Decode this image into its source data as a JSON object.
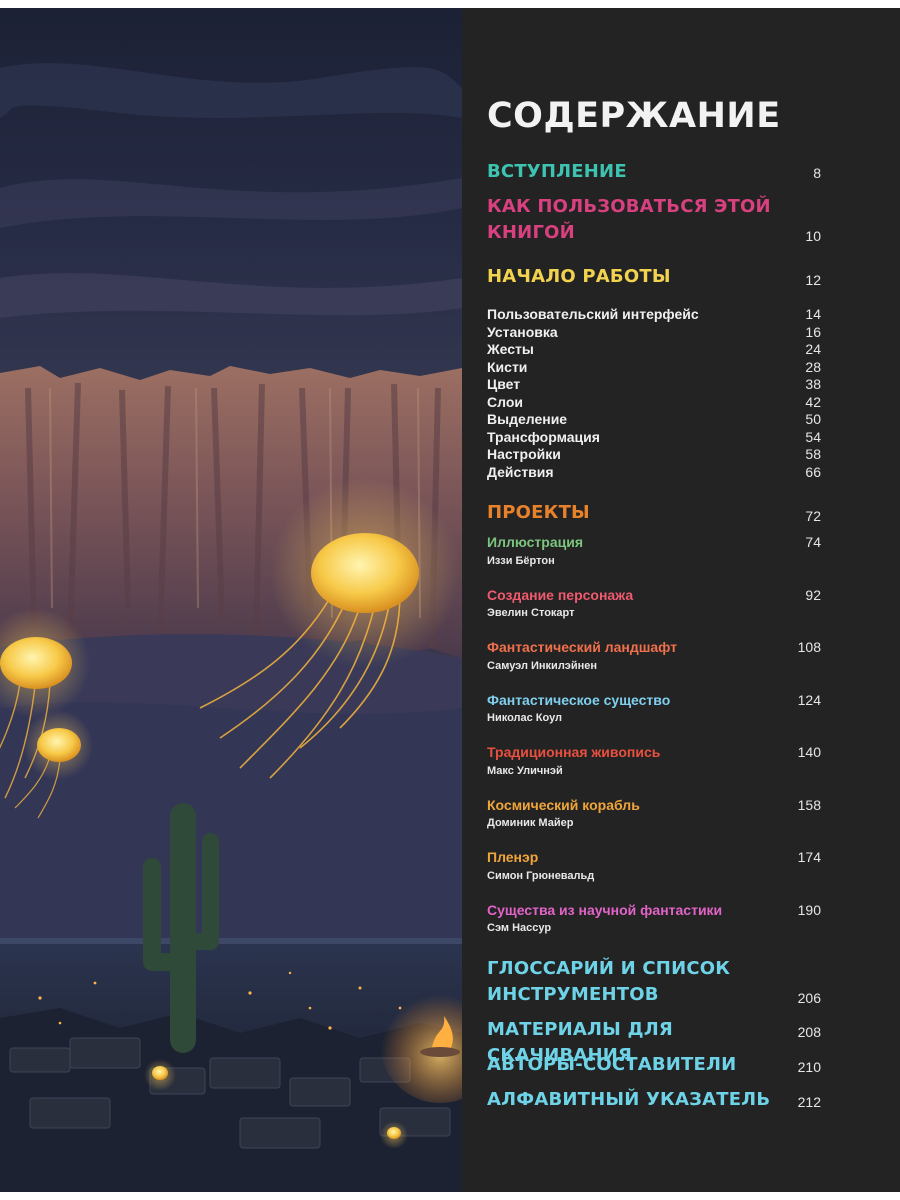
{
  "title": "СОДЕРЖАНИЕ",
  "colors": {
    "panel_bg": "#232323",
    "teal": "#3ec3b0",
    "magenta": "#d8407f",
    "yellow": "#f2d34f",
    "orange": "#e8822a",
    "green": "#7cc47f",
    "pink": "#ef5a6e",
    "coral": "#f0704d",
    "sky": "#7fd0ee",
    "red": "#e8503f",
    "gold": "#f0a53a",
    "amber": "#f0a53a",
    "violet": "#e264c8",
    "cyan": "#6fd3e8"
  },
  "sections": [
    {
      "label": "ВСТУПЛЕНИЕ",
      "page": "8"
    },
    {
      "label_line1": "КАК ПОЛЬЗОВАТЬСЯ ЭТОЙ",
      "label_line2": "КНИГОЙ",
      "page": "10"
    },
    {
      "label": "НАЧАЛО РАБОТЫ",
      "page": "12"
    }
  ],
  "getting_started": [
    {
      "label": "Пользовательский интерфейс",
      "page": "14"
    },
    {
      "label": "Установка",
      "page": "16"
    },
    {
      "label": "Жесты",
      "page": "24"
    },
    {
      "label": "Кисти",
      "page": "28"
    },
    {
      "label": "Цвет",
      "page": "38"
    },
    {
      "label": "Слои",
      "page": "42"
    },
    {
      "label": "Выделение",
      "page": "50"
    },
    {
      "label": "Трансформация",
      "page": "54"
    },
    {
      "label": "Настройки",
      "page": "58"
    },
    {
      "label": "Действия",
      "page": "66"
    }
  ],
  "projects_heading": {
    "label": "ПРОЕКТЫ",
    "page": "72"
  },
  "projects": [
    {
      "title": "Иллюстрация",
      "author": "Иззи Бёртон",
      "page": "74"
    },
    {
      "title": "Создание персонажа",
      "author": "Эвелин Стокарт",
      "page": "92"
    },
    {
      "title": "Фантастический ландшафт",
      "author": "Самуэл Инкилэйнен",
      "page": "108"
    },
    {
      "title": "Фантастическое существо",
      "author": "Николас Коул",
      "page": "124"
    },
    {
      "title": "Традиционная живопись",
      "author": "Макс Уличнэй",
      "page": "140"
    },
    {
      "title": "Космический корабль",
      "author": "Доминик Майер",
      "page": "158"
    },
    {
      "title": "Пленэр",
      "author": "Симон Грюневальд",
      "page": "174"
    },
    {
      "title": "Существа из научной фантастики",
      "author": "Сэм Нассур",
      "page": "190"
    }
  ],
  "appendix": [
    {
      "label_line1": "ГЛОССАРИЙ И СПИСОК",
      "label_line2": "ИНСТРУМЕНТОВ",
      "page": "206"
    },
    {
      "label": "МАТЕРИАЛЫ ДЛЯ СКАЧИВАНИЯ",
      "page": "208"
    },
    {
      "label": "АВТОРЫ-СОСТАВИТЕЛИ",
      "page": "210"
    },
    {
      "label": "АЛФАВИТНЫЙ УКАЗАТЕЛЬ",
      "page": "212"
    }
  ]
}
